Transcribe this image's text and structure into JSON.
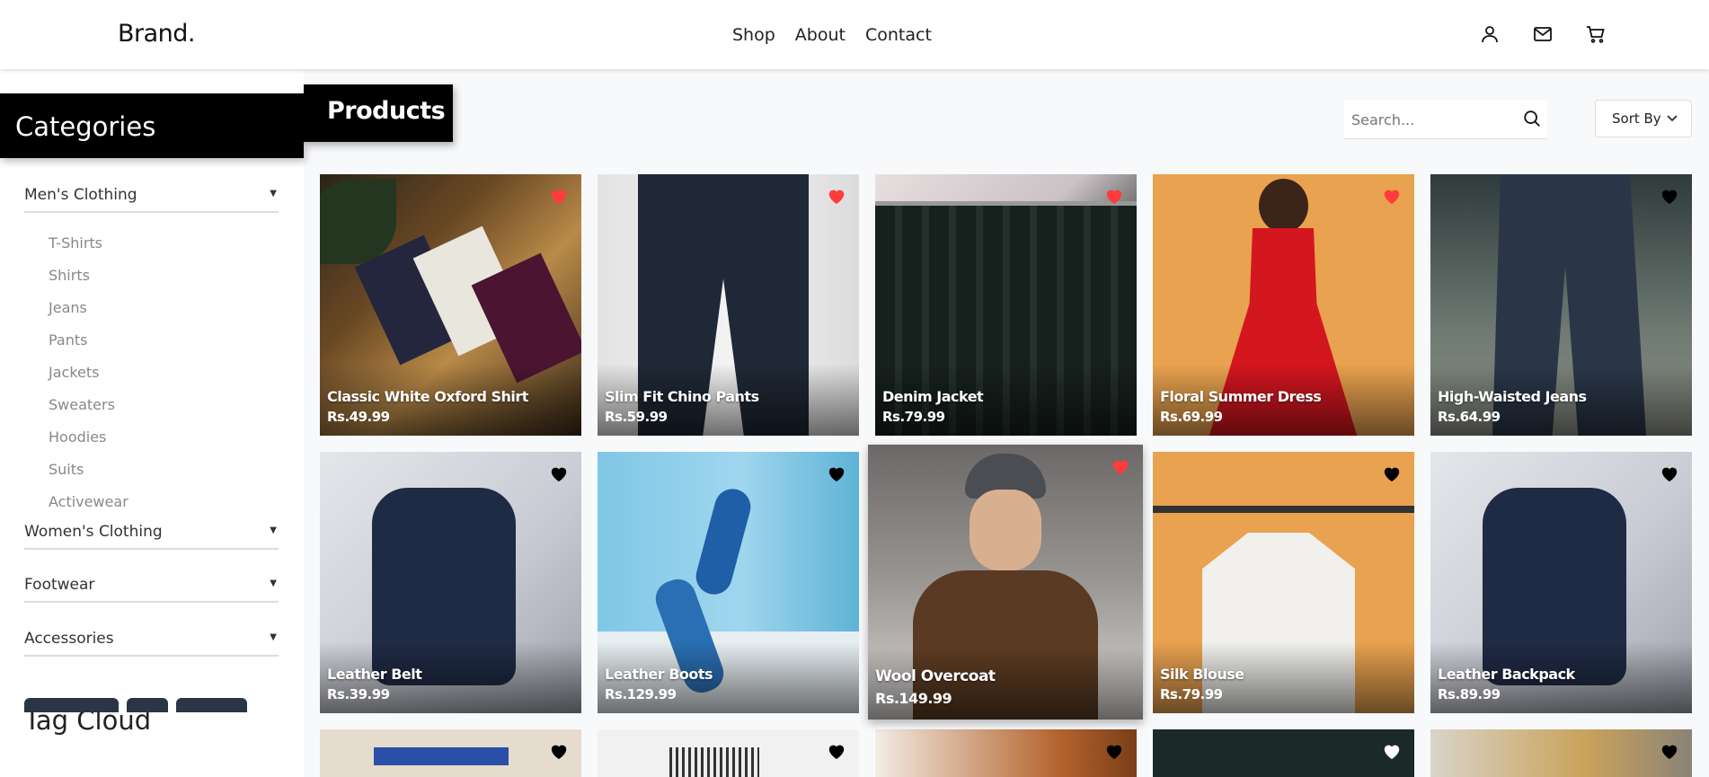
{
  "header": {
    "brand": "Brand.",
    "nav": [
      "Shop",
      "About",
      "Contact"
    ],
    "icons": [
      "user-icon",
      "mail-icon",
      "cart-icon"
    ]
  },
  "sidebar": {
    "title": "Categories",
    "categories": [
      {
        "label": "Men's Clothing",
        "expanded": true,
        "items": [
          "T-Shirts",
          "Shirts",
          "Jeans",
          "Pants",
          "Jackets",
          "Sweaters",
          "Hoodies",
          "Suits",
          "Activewear"
        ]
      },
      {
        "label": "Women's Clothing",
        "expanded": false
      },
      {
        "label": "Footwear",
        "expanded": false
      },
      {
        "label": "Accessories",
        "expanded": false
      }
    ],
    "tag_cloud_title": "Tag Cloud"
  },
  "main": {
    "title": "Products",
    "search_placeholder": "Search...",
    "sort_label": "Sort By",
    "products": [
      {
        "name": "Classic White Oxford Shirt",
        "price": "Rs.49.99",
        "favorite": true
      },
      {
        "name": "Slim Fit Chino Pants",
        "price": "Rs.59.99",
        "favorite": true
      },
      {
        "name": "Denim Jacket",
        "price": "Rs.79.99",
        "favorite": true
      },
      {
        "name": "Floral Summer Dress",
        "price": "Rs.69.99",
        "favorite": true
      },
      {
        "name": "High-Waisted Jeans",
        "price": "Rs.64.99",
        "favorite": false
      },
      {
        "name": "Leather Belt",
        "price": "Rs.39.99",
        "favorite": false
      },
      {
        "name": "Leather Boots",
        "price": "Rs.129.99",
        "favorite": false
      },
      {
        "name": "Wool Overcoat",
        "price": "Rs.149.99",
        "favorite": true
      },
      {
        "name": "Silk Blouse",
        "price": "Rs.79.99",
        "favorite": false
      },
      {
        "name": "Leather Backpack",
        "price": "Rs.89.99",
        "favorite": false
      }
    ]
  },
  "colors": {
    "heart_active": "#ff3b3b",
    "heart_inactive": "#000000",
    "accent": "#000000"
  }
}
